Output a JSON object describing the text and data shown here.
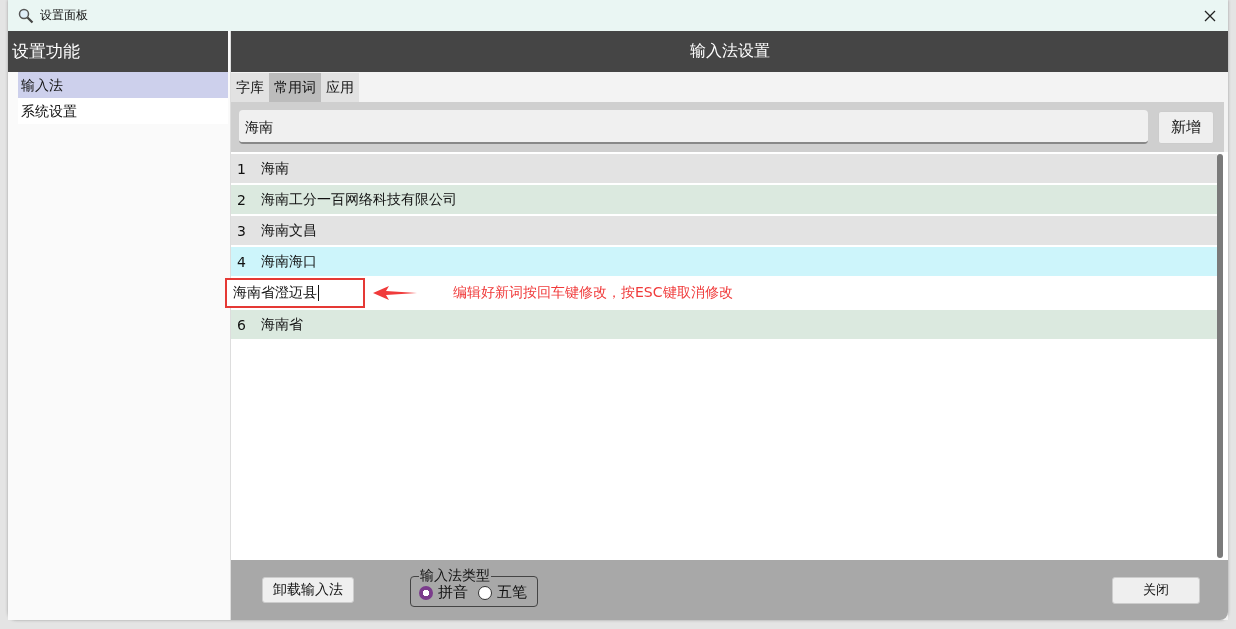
{
  "window": {
    "title": "设置面板"
  },
  "sidebar": {
    "title": "设置功能",
    "items": [
      {
        "label": "输入法",
        "selected": true
      },
      {
        "label": "系统设置",
        "selected": false
      }
    ]
  },
  "panel": {
    "title": "输入法设置"
  },
  "tabs": [
    {
      "label": "字库",
      "selected": false
    },
    {
      "label": "常用词",
      "selected": true
    },
    {
      "label": "应用",
      "selected": false
    }
  ],
  "search": {
    "value": "海南",
    "add_button": "新增"
  },
  "rows": [
    {
      "kind": "item",
      "index": "1",
      "text": "海南",
      "color": "#e3e3e3"
    },
    {
      "kind": "item",
      "index": "2",
      "text": "海南工分一百网络科技有限公司",
      "color": "#dbe9df"
    },
    {
      "kind": "item",
      "index": "3",
      "text": "海南文昌",
      "color": "#e3e3e3"
    },
    {
      "kind": "item",
      "index": "4",
      "text": "海南海口",
      "color": "#cdf5fb"
    },
    {
      "kind": "editing",
      "value": "海南省澄迈县",
      "note": "编辑好新词按回车键修改，按ESC键取消修改",
      "color": "#ffffff"
    },
    {
      "kind": "item",
      "index": "6",
      "text": "海南省",
      "color": "#dbe9df"
    }
  ],
  "footer": {
    "uninstall_button": "卸载输入法",
    "type_group": {
      "legend": "输入法类型",
      "options": [
        {
          "label": "拼音",
          "selected": true
        },
        {
          "label": "五笔",
          "selected": false
        }
      ]
    },
    "close_button": "关闭"
  }
}
